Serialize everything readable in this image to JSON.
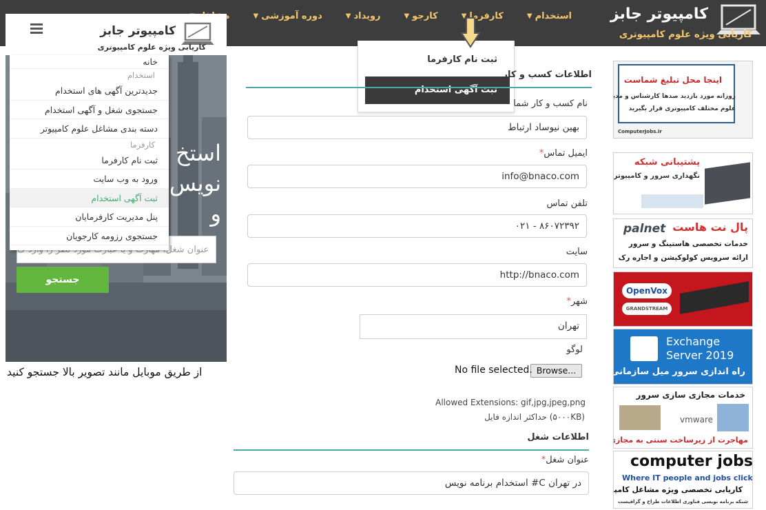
{
  "site": {
    "name": "کامپیوتر جابز",
    "tagline": "کاریابی ویژه علوم کامپیوتری"
  },
  "nav": {
    "items": [
      "استخدام",
      "کارفرما",
      "کارجو",
      "رویداد",
      "دوره آموزشی",
      "مشاغل"
    ]
  },
  "dropdown": {
    "items": [
      "ثبت نام کارفرما",
      "ثبت آگهی استخدام"
    ]
  },
  "mobile": {
    "site_name": "کامپیوتر جابز",
    "tagline": "کاریابی ویژه علوم کامپیوتری",
    "menu": [
      {
        "label": "خانه",
        "kind": "first"
      },
      {
        "label": "استخدام",
        "kind": "head"
      },
      {
        "label": "جدیدترین آگهی های استخدام",
        "kind": "item"
      },
      {
        "label": "جستجوی شغل و آگهی استخدام",
        "kind": "item"
      },
      {
        "label": "دسته بندی مشاغل علوم کامپیوتر",
        "kind": "item"
      },
      {
        "label": "کارفرما",
        "kind": "head"
      },
      {
        "label": "ثبت نام کارفرما",
        "kind": "item"
      },
      {
        "label": "ورود به وب سایت",
        "kind": "item"
      },
      {
        "label": "ثبت آگهی استخدام",
        "kind": "active"
      },
      {
        "label": "پنل مدیریت کارفرمایان",
        "kind": "item"
      },
      {
        "label": "جستجوی رزومه کارجویان",
        "kind": "item"
      }
    ],
    "hero_text": [
      "استخ",
      "نویس",
      "و"
    ],
    "search_placeholder": "عنوان شغل، مهارت و یا عبارت مورد نظر را وارد ک",
    "search_button": "جستجو"
  },
  "caption": "از طریق موبایل مانند تصویر بالا جستجو کنید",
  "form": {
    "business_section": "اطلاعات کسب و کار",
    "business_name_label": "نام کسب و کار شما",
    "business_name_value": "بهین نیوساد ارتباط",
    "email_label": "ایمیل تماس",
    "email_value": "info@bnaco.com",
    "phone_label": "تلفن تماس",
    "phone_value": "۰۲۱ - ۸۶۰۷۲۳۹۲",
    "site_label": "سایت",
    "site_value": "http://bnaco.com",
    "city_label": "شهر",
    "city_value": "تهران",
    "logo_label": "لوگو",
    "browse_label": "Browse...",
    "no_file": "No file selected.",
    "allowed": "Allowed Extensions: gif,jpg,jpeg,png",
    "max_size": "حداکثر اندازه فایل (۵۰۰۰KB)",
    "job_section": "اطلاعات شغل",
    "job_title_label": "عنوان شغل",
    "job_title_value": "استخدام برنامه نویس #C در تهران",
    "required_mark": "*"
  },
  "ads": [
    {
      "line1": "اینجا محل تبلیغ شماست",
      "line2": "روزانه مورد بازدید صدها کارشناس و مدیر",
      "line3": "علوم مختلف کامپیوتری قرار بگیرید",
      "footer": "ComputerJobs.ir"
    },
    {
      "line1": "پشتیبانی شبکه",
      "line2": "نگهداری سرور و کامپیوتر"
    },
    {
      "line1": "پال نت هاست",
      "brand": "palnet",
      "line2": "خدمات تخصصی هاستینگ و سرور",
      "line3": "ارائه سرویس کولوکیشن و اجاره رک"
    },
    {
      "line1": "OpenVox",
      "line2": "GRANDSTREAM"
    },
    {
      "line1": "Exchange",
      "line2": "Server 2019",
      "line3": "راه اندازی سرور میل سازمانی"
    },
    {
      "line1": "خدمات مجازی سازی سرور",
      "line2": "vmware",
      "line3": "مهاجرت از زیرساخت سنتی به مجازی"
    },
    {
      "line1": "computer jobs",
      "line2": "Where IT people and jobs click",
      "line3": "کاریابی تخصصی ویژه مشاغل کامپیوتری",
      "line4": "شبکه   برنامه نویسی   فناوری اطلاعات   طراح و گرافیست"
    }
  ],
  "colors": {
    "topbar": "#3d3d3d",
    "accent_gold": "#f2c66d",
    "teal_rule": "#48a9a6",
    "search_green": "#62b53d",
    "required": "#d9534f"
  }
}
